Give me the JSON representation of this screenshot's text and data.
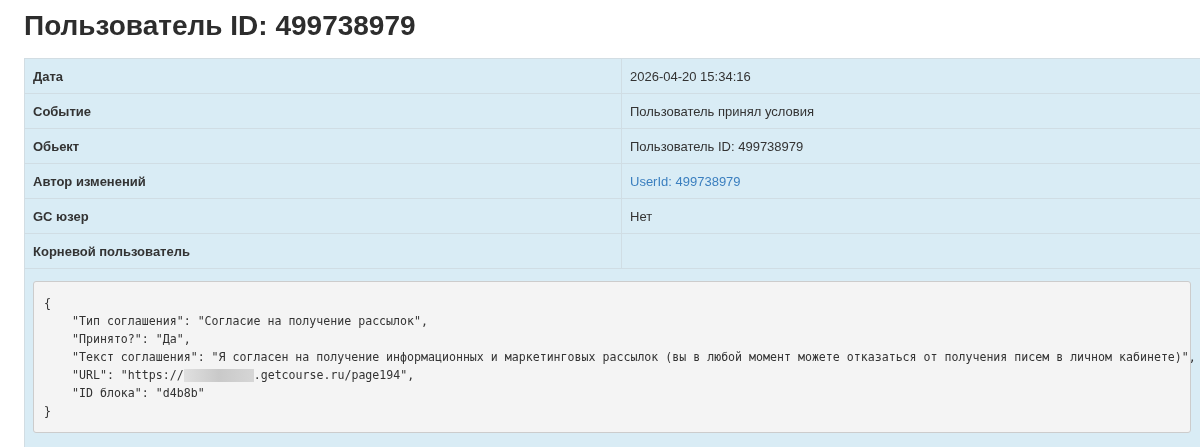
{
  "title": "Пользователь ID: 499738979",
  "rows": [
    {
      "label": "Дата",
      "value": "2026-04-20 15:34:16",
      "kind": "text"
    },
    {
      "label": "Событие",
      "value": "Пользователь принял условия",
      "kind": "text"
    },
    {
      "label": "Обьект",
      "value": "Пользователь ID: 499738979",
      "kind": "text"
    },
    {
      "label": "Автор изменений",
      "value": "UserId: 499738979",
      "kind": "link"
    },
    {
      "label": "GC юзер",
      "value": "Нет",
      "kind": "text"
    },
    {
      "label": "Корневой пользователь",
      "kind": "empty"
    }
  ],
  "code": {
    "open": "{",
    "close": "}",
    "lines": [
      {
        "parts": [
          "\"Тип соглашения\": \"Согласие на получение рассылок\","
        ],
        "redacted": false
      },
      {
        "parts": [
          "\"Принято?\": \"Да\","
        ],
        "redacted": false
      },
      {
        "parts": [
          "\"Текст соглашения\": \"Я согласен на получение информационных и маркетинговых рассылок (вы в любой момент можете отказаться от получения писем в личном кабинете)\","
        ],
        "redacted": false
      },
      {
        "parts": [
          "\"URL\": \"https://",
          ".getcourse.ru/page194\","
        ],
        "redacted": true
      },
      {
        "parts": [
          "\"ID блока\": \"d4b8b\""
        ],
        "redacted": false
      }
    ]
  }
}
